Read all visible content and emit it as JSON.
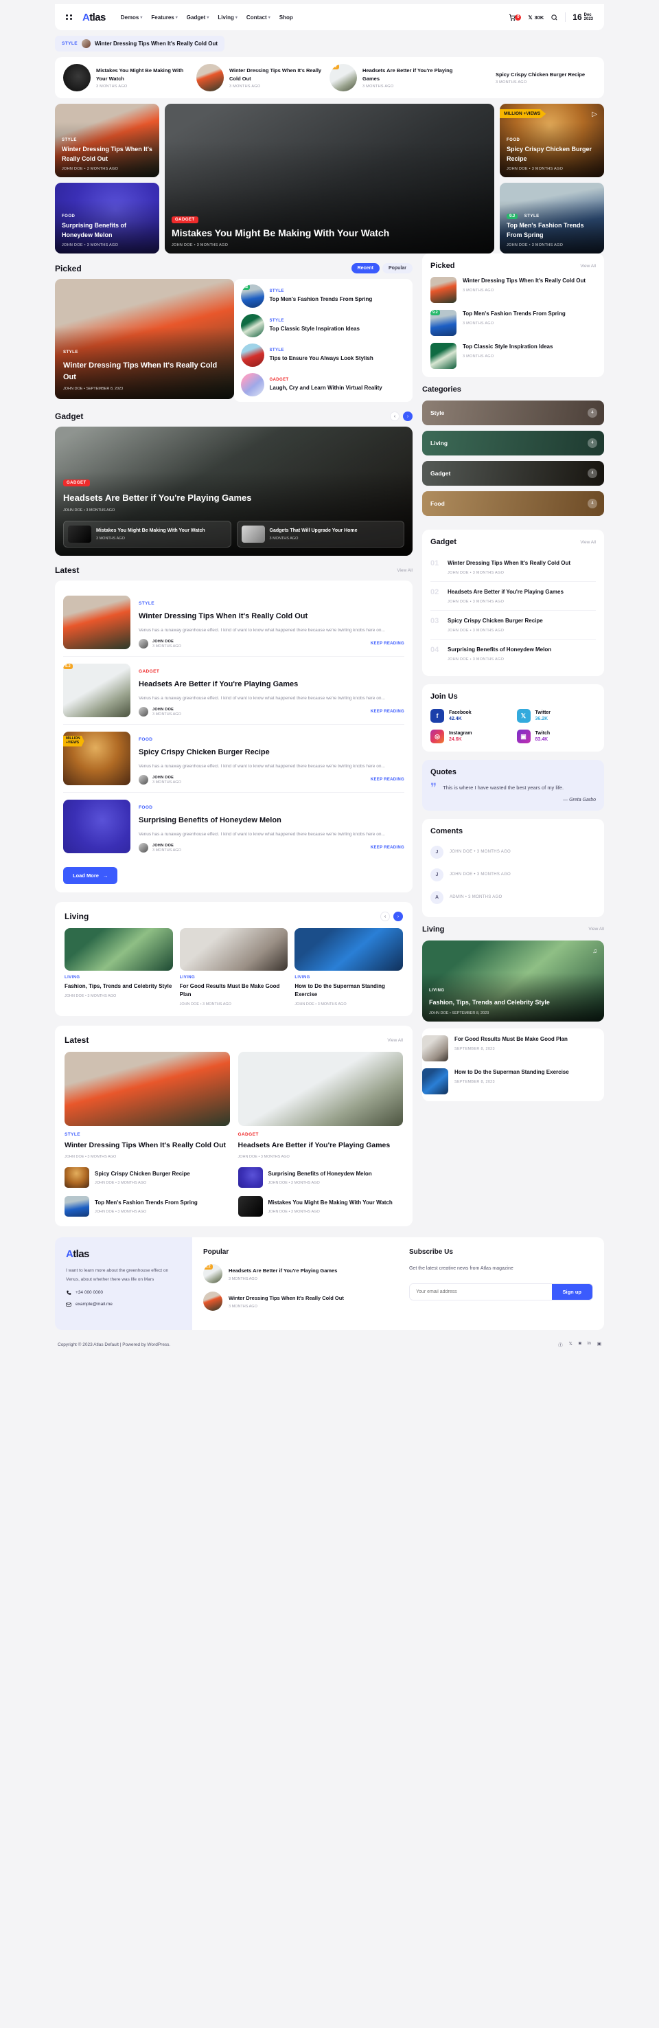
{
  "header": {
    "logo": "Atlas",
    "logo_first": "A",
    "logo_rest": "tlas",
    "nav": [
      {
        "label": "Demos"
      },
      {
        "label": "Features"
      },
      {
        "label": "Gadget"
      },
      {
        "label": "Living"
      },
      {
        "label": "Contact"
      },
      {
        "label": "Shop"
      }
    ],
    "cart_count": "0",
    "x_count": "30K",
    "date_day": "16",
    "date_month": "Dec",
    "date_year": "2023"
  },
  "ticker": {
    "category": "STYLE",
    "title": "Winter Dressing Tips When It's Really Cold Out"
  },
  "stories": [
    {
      "title": "Mistakes You Might Be Making With Your Watch",
      "meta": "3 MONTHS AGO",
      "score": ""
    },
    {
      "title": "Winter Dressing Tips When It's Really Cold Out",
      "meta": "3 MONTHS AGO",
      "score": ""
    },
    {
      "title": "Headsets Are Better if You're Playing Games",
      "meta": "3 MONTHS AGO",
      "score": "5.2"
    },
    {
      "title": "Spicy Crispy Chicken Burger Recipe",
      "meta": "3 MONTHS AGO",
      "score": ""
    }
  ],
  "hero": {
    "left_top": {
      "cat": "STYLE",
      "title": "Winter Dressing Tips When It's Really Cold Out",
      "meta": "JOHN DOE  •  3 MONTHS AGO"
    },
    "left_bottom": {
      "cat": "FOOD",
      "title": "Surprising Benefits of Honeydew Melon",
      "meta": "JOHN DOE  •  3 MONTHS AGO"
    },
    "center": {
      "cat": "GADGET",
      "title": "Mistakes You Might Be Making With Your Watch",
      "meta": "JOHN DOE  •  3 MONTHS AGO"
    },
    "right_top": {
      "badge": "MILLION +VIEWS",
      "cat": "FOOD",
      "title": "Spicy Crispy Chicken Burger Recipe",
      "meta": "JOHN DOE  •  3 MONTHS AGO"
    },
    "right_bottom": {
      "score": "9.2",
      "cat": "STYLE",
      "title": "Top Men's Fashion Trends From Spring",
      "meta": "JOHN DOE  •  3 MONTHS AGO"
    }
  },
  "picked": {
    "heading": "Picked",
    "tab_recent": "Recent",
    "tab_popular": "Popular",
    "featured": {
      "cat": "STYLE",
      "title": "Winter Dressing Tips When It's Really Cold Out",
      "meta": "JOHN DOE  •  SEPTEMBER 8, 2023"
    },
    "items": [
      {
        "cat": "STYLE",
        "title": "Top Men's Fashion Trends From Spring",
        "score": "9.2"
      },
      {
        "cat": "STYLE",
        "title": "Top Classic Style Inspiration Ideas",
        "score": ""
      },
      {
        "cat": "STYLE",
        "title": "Tips to Ensure You Always Look Stylish",
        "score": ""
      },
      {
        "cat": "GADGET",
        "title": "Laugh, Cry and Learn Within Virtual Reality",
        "score": ""
      }
    ]
  },
  "gadget_section": {
    "heading": "Gadget",
    "feature": {
      "cat": "GADGET",
      "title": "Headsets Are Better if You're Playing Games",
      "meta": "JOHN DOE  •  3 MONTHS AGO"
    },
    "subcards": [
      {
        "title": "Mistakes You Might Be Making With Your Watch",
        "meta": "3 MONTHS AGO"
      },
      {
        "title": "Gadgets That Will Upgrade Your Home",
        "meta": "3 MONTHS AGO"
      }
    ]
  },
  "latest": {
    "heading": "Latest",
    "view_all": "View All",
    "load_more": "Load More",
    "items": [
      {
        "cat": "STYLE",
        "cat_color": "blue",
        "title": "Winter Dressing Tips When It's Really Cold Out",
        "excerpt": "Venus has a runaway greenhouse effect. I kind of want to know what happened there because we're twirling knobs here on...",
        "author": "JOHN DOE",
        "date": "3 MONTHS AGO",
        "cta": "KEEP READING",
        "score": ""
      },
      {
        "cat": "GADGET",
        "cat_color": "red",
        "title": "Headsets Are Better if You're Playing Games",
        "excerpt": "Venus has a runaway greenhouse effect. I kind of want to know what happened there because we're twirling knobs here on...",
        "author": "JOHN DOE",
        "date": "3 MONTHS AGO",
        "cta": "KEEP READING",
        "score": "5.2"
      },
      {
        "cat": "FOOD",
        "cat_color": "blue",
        "title": "Spicy Crispy Chicken Burger Recipe",
        "excerpt": "Venus has a runaway greenhouse effect. I kind of want to know what happened there because we're twirling knobs here on...",
        "author": "JOHN DOE",
        "date": "3 MONTHS AGO",
        "cta": "KEEP READING",
        "score": ""
      },
      {
        "cat": "FOOD",
        "cat_color": "blue",
        "title": "Surprising Benefits of Honeydew Melon",
        "excerpt": "Venus has a runaway greenhouse effect. I kind of want to know what happened there because we're twirling knobs here on...",
        "author": "JOHN DOE",
        "date": "3 MONTHS AGO",
        "cta": "KEEP READING",
        "score": ""
      }
    ]
  },
  "living_section": {
    "heading": "Living",
    "items": [
      {
        "cat": "LIVING",
        "title": "Fashion, Tips, Trends and Celebrity Style",
        "meta": "JOHN DOE  •  3 MONTHS AGO"
      },
      {
        "cat": "LIVING",
        "title": "For Good Results Must Be Make Good Plan",
        "meta": "JOHN DOE  •  3 MONTHS AGO"
      },
      {
        "cat": "LIVING",
        "title": "How to Do the Superman Standing Exercise",
        "meta": "JOHN DOE  •  3 MONTHS AGO"
      }
    ]
  },
  "latest_bottom": {
    "heading": "Latest",
    "view_all": "View All",
    "big": [
      {
        "cat": "STYLE",
        "cat_color": "blue",
        "title": "Winter Dressing Tips When It's Really Cold Out",
        "meta": "JOHN DOE  •  3 MONTHS AGO"
      },
      {
        "cat": "GADGET",
        "cat_color": "red",
        "title": "Headsets Are Better if You're Playing Games",
        "meta": "JOHN DOE  •  3 MONTHS AGO"
      }
    ],
    "small": [
      {
        "title": "Spicy Crispy Chicken Burger Recipe",
        "meta": "JOHN DOE  •  3 MONTHS AGO"
      },
      {
        "title": "Surprising Benefits of Honeydew Melon",
        "meta": "JOHN DOE  •  3 MONTHS AGO"
      },
      {
        "title": "Top Men's Fashion Trends From Spring",
        "meta": "JOHN DOE  •  3 MONTHS AGO"
      },
      {
        "title": "Mistakes You Might Be Making With Your Watch",
        "meta": "JOHN DOE  •  3 MONTHS AGO"
      }
    ]
  },
  "sidebar": {
    "picked": {
      "heading": "Picked",
      "view_all": "View All",
      "items": [
        {
          "title": "Winter Dressing Tips When It's Really Cold Out",
          "meta": "3 MONTHS AGO",
          "score": ""
        },
        {
          "title": "Top Men's Fashion Trends From Spring",
          "meta": "3 MONTHS AGO",
          "score": "9.2"
        },
        {
          "title": "Top Classic Style Inspiration Ideas",
          "meta": "3 MONTHS AGO",
          "score": ""
        }
      ]
    },
    "categories": {
      "heading": "Categories",
      "items": [
        {
          "name": "Style",
          "count": "4"
        },
        {
          "name": "Living",
          "count": "4"
        },
        {
          "name": "Gadget",
          "count": "4"
        },
        {
          "name": "Food",
          "count": "4"
        }
      ]
    },
    "gadget": {
      "heading": "Gadget",
      "view_all": "View All",
      "items": [
        {
          "n": "01",
          "title": "Winter Dressing Tips When It's Really Cold Out",
          "meta": "JOHN DOE  •  3 MONTHS AGO"
        },
        {
          "n": "02",
          "title": "Headsets Are Better if You're Playing Games",
          "meta": "JOHN DOE  •  3 MONTHS AGO"
        },
        {
          "n": "03",
          "title": "Spicy Crispy Chicken Burger Recipe",
          "meta": "JOHN DOE  •  3 MONTHS AGO"
        },
        {
          "n": "04",
          "title": "Surprising Benefits of Honeydew Melon",
          "meta": "JOHN DOE  •  3 MONTHS AGO"
        }
      ]
    },
    "join": {
      "heading": "Join Us",
      "items": [
        {
          "name": "Facebook",
          "count": "42.4K",
          "color": "#1b3faa",
          "glyph": "f",
          "text_color": "#1b3faa"
        },
        {
          "name": "Twitter",
          "count": "36.2K",
          "color": "#33aadd",
          "glyph": "✕",
          "text_color": "#33aadd"
        },
        {
          "name": "Instagram",
          "count": "24.6K",
          "color": "#e33a5e",
          "glyph": "◙",
          "text_color": "#e33a5e"
        },
        {
          "name": "Twitch",
          "count": "83.4K",
          "color": "#9a2fc9",
          "glyph": "▣",
          "text_color": "#9a2fc9"
        }
      ]
    },
    "quotes": {
      "heading": "Quotes",
      "text": "This is where I have wasted the best years of my life.",
      "author": "— Greta Garbo"
    },
    "comments": {
      "heading": "Coments",
      "items": [
        {
          "initial": "J",
          "meta": "JOHN DOE  •  3 MONTHS AGO"
        },
        {
          "initial": "J",
          "meta": "JOHN DOE  •  3 MONTHS AGO"
        },
        {
          "initial": "A",
          "meta": "ADMIN  •  3 MONTHS AGO"
        }
      ]
    },
    "living": {
      "heading": "Living",
      "view_all": "View All",
      "feature": {
        "cat": "LIVING",
        "title": "Fashion, Tips, Trends and Celebrity Style",
        "meta": "JOHN DOE  •  SEPTEMBER 8, 2023"
      },
      "items": [
        {
          "title": "For Good Results Must Be Make Good Plan",
          "meta": "SEPTEMBER 8, 2023"
        },
        {
          "title": "How to Do the Superman Standing Exercise",
          "meta": "SEPTEMBER 8, 2023"
        }
      ]
    }
  },
  "footer": {
    "logo_first": "A",
    "logo_rest": "tlas",
    "desc": "I want to learn more about the greenhouse effect on Venus, about whether there was life on Mars",
    "phone": "+34 000 0000",
    "email": "example@mail.me",
    "popular_heading": "Popular",
    "popular": [
      {
        "title": "Headsets Are Better if You're Playing Games",
        "meta": "3 MONTHS AGO",
        "score": "5.2"
      },
      {
        "title": "Winter Dressing Tips When It's Really Cold Out",
        "meta": "3 MONTHS AGO",
        "score": ""
      }
    ],
    "subscribe_heading": "Subscribe Us",
    "subscribe_text": "Get the latest creative news from Atlas magazine",
    "email_placeholder": "Your email address",
    "signup_label": "Sign up",
    "copyright": "Copyright © 2023 Atlas Default | Powered by WordPress."
  }
}
